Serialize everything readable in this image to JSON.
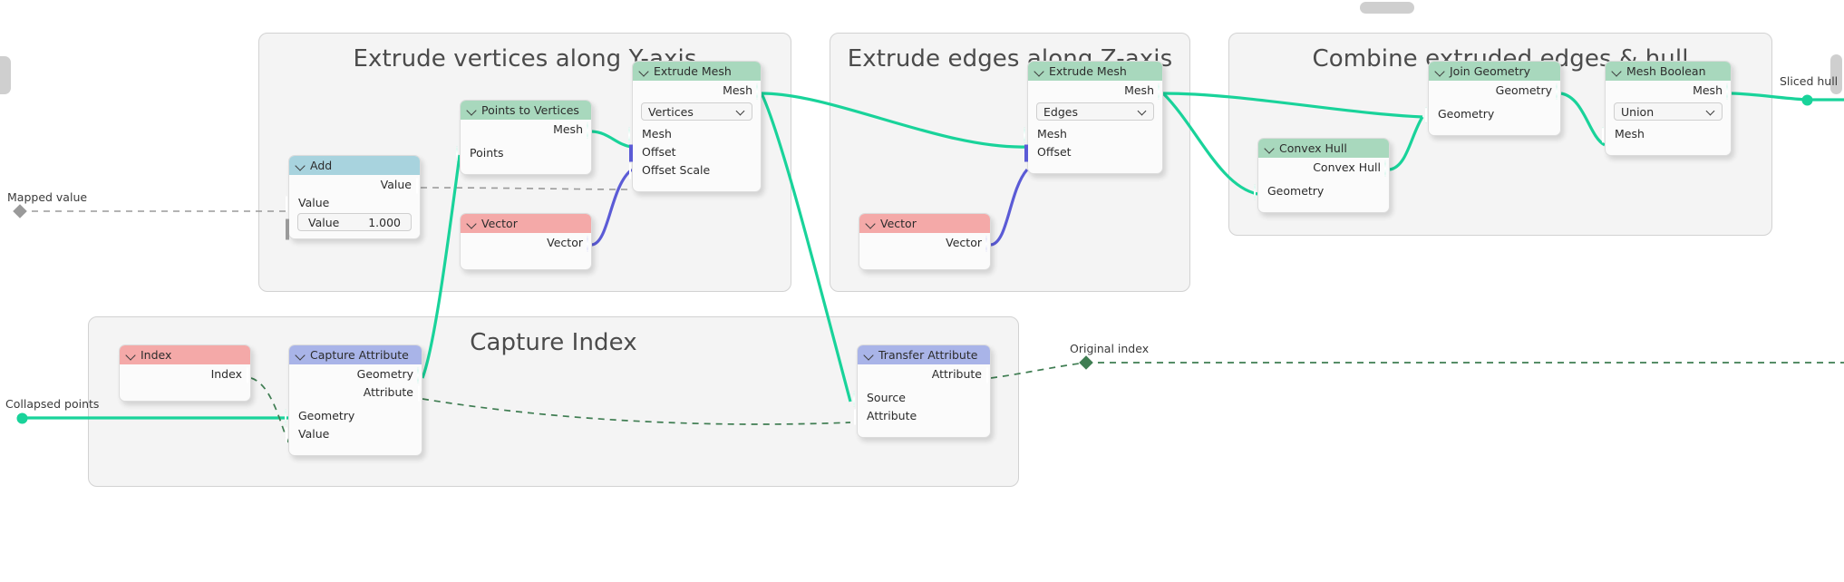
{
  "editor": {
    "background": "#ffffff",
    "scrollbars": [
      "scrollbar-horizontal",
      "scrollbar-vertical",
      "scrollbar-left"
    ]
  },
  "frames": [
    {
      "id": "frame-extrude-vertices",
      "title": "Extrude vertices along Y-axis"
    },
    {
      "id": "frame-extrude-edges",
      "title": "Extrude edges along Z-axis"
    },
    {
      "id": "frame-combine",
      "title": "Combine extruded edges & hull"
    },
    {
      "id": "frame-capture-index",
      "title": "Capture Index"
    }
  ],
  "nodes": [
    {
      "id": "node-add",
      "title": "Add",
      "header_color": "#a8d3de",
      "outputs": [
        {
          "label": "Value",
          "socket": "diamond-gray"
        }
      ],
      "inputs": [
        {
          "label": "Value",
          "socket": "diamond-gray"
        }
      ],
      "widgets": [
        {
          "type": "value-field",
          "label": "Value",
          "value": "1.000"
        }
      ]
    },
    {
      "id": "node-points-to-vertices",
      "title": "Points to Vertices",
      "header_color": "#a8d8bd",
      "outputs": [
        {
          "label": "Mesh",
          "socket": "dot-green"
        }
      ],
      "inputs": [
        {
          "label": "Points",
          "socket": "dot-green"
        }
      ],
      "widgets": []
    },
    {
      "id": "node-vector-y",
      "title": "Vector",
      "header_color": "#f4a9a8",
      "outputs": [
        {
          "label": "Vector",
          "socket": "dot-purple"
        }
      ],
      "inputs": [],
      "widgets": []
    },
    {
      "id": "node-extrude-mesh-vertices",
      "title": "Extrude Mesh",
      "header_color": "#a8d8bd",
      "outputs": [
        {
          "label": "Mesh",
          "socket": "dot-green"
        }
      ],
      "inputs": [
        {
          "label": "Mesh",
          "socket": "dot-green"
        },
        {
          "label": "Offset",
          "socket": "diamond-purple-hollow"
        },
        {
          "label": "Offset Scale",
          "socket": "diamond-gray"
        }
      ],
      "widgets": [
        {
          "type": "dropdown",
          "value": "Vertices"
        }
      ]
    },
    {
      "id": "node-vector-z",
      "title": "Vector",
      "header_color": "#f4a9a8",
      "outputs": [
        {
          "label": "Vector",
          "socket": "dot-purple"
        }
      ],
      "inputs": [],
      "widgets": []
    },
    {
      "id": "node-extrude-mesh-edges",
      "title": "Extrude Mesh",
      "header_color": "#a8d8bd",
      "outputs": [
        {
          "label": "Mesh",
          "socket": "dot-green"
        }
      ],
      "inputs": [
        {
          "label": "Mesh",
          "socket": "dot-green"
        },
        {
          "label": "Offset",
          "socket": "diamond-purple-hollow"
        }
      ],
      "widgets": [
        {
          "type": "dropdown",
          "value": "Edges"
        }
      ]
    },
    {
      "id": "node-convex-hull",
      "title": "Convex Hull",
      "header_color": "#a8d8bd",
      "outputs": [
        {
          "label": "Convex Hull",
          "socket": "dot-green"
        }
      ],
      "inputs": [
        {
          "label": "Geometry",
          "socket": "dot-green"
        }
      ],
      "widgets": []
    },
    {
      "id": "node-join-geometry",
      "title": "Join Geometry",
      "header_color": "#a8d8bd",
      "outputs": [
        {
          "label": "Geometry",
          "socket": "dot-green"
        }
      ],
      "inputs": [
        {
          "label": "Geometry",
          "socket": "dot-green-multi"
        }
      ],
      "widgets": []
    },
    {
      "id": "node-mesh-boolean",
      "title": "Mesh Boolean",
      "header_color": "#a8d8bd",
      "outputs": [
        {
          "label": "Mesh",
          "socket": "dot-green"
        }
      ],
      "inputs": [
        {
          "label": "Mesh",
          "socket": "dot-green-multi"
        }
      ],
      "widgets": [
        {
          "type": "dropdown",
          "value": "Union"
        }
      ]
    },
    {
      "id": "node-index",
      "title": "Index",
      "header_color": "#f4a9a8",
      "outputs": [
        {
          "label": "Index",
          "socket": "diamond-green"
        }
      ],
      "inputs": [],
      "widgets": []
    },
    {
      "id": "node-capture-attribute",
      "title": "Capture Attribute",
      "header_color": "#a9b4e8",
      "outputs": [
        {
          "label": "Geometry",
          "socket": "dot-green"
        },
        {
          "label": "Attribute",
          "socket": "diamond-green"
        }
      ],
      "inputs": [
        {
          "label": "Geometry",
          "socket": "dot-green"
        },
        {
          "label": "Value",
          "socket": "diamond-green"
        }
      ],
      "widgets": []
    },
    {
      "id": "node-transfer-attribute",
      "title": "Transfer Attribute",
      "header_color": "#a9b4e8",
      "outputs": [
        {
          "label": "Attribute",
          "socket": "diamond-green"
        }
      ],
      "inputs": [
        {
          "label": "Source",
          "socket": "dot-green"
        },
        {
          "label": "Attribute",
          "socket": "diamond-green"
        }
      ],
      "widgets": []
    }
  ],
  "link_labels": [
    {
      "id": "label-mapped-value",
      "text": "Mapped value"
    },
    {
      "id": "label-collapsed-points",
      "text": "Collapsed points"
    },
    {
      "id": "label-original-index",
      "text": "Original index"
    },
    {
      "id": "label-sliced-hull",
      "text": "Sliced hull"
    }
  ],
  "colors": {
    "geometry_socket": "#19d39a",
    "field_socket": "#3f7d52",
    "vector_socket": "#5b5bd6",
    "gray_socket": "#9a9a9a",
    "geometry_header": "#a8d8bd",
    "vector_header": "#f4a9a8",
    "math_header": "#a8d3de",
    "attribute_header": "#a9b4e8",
    "frame_bg": "#f4f4f4"
  }
}
